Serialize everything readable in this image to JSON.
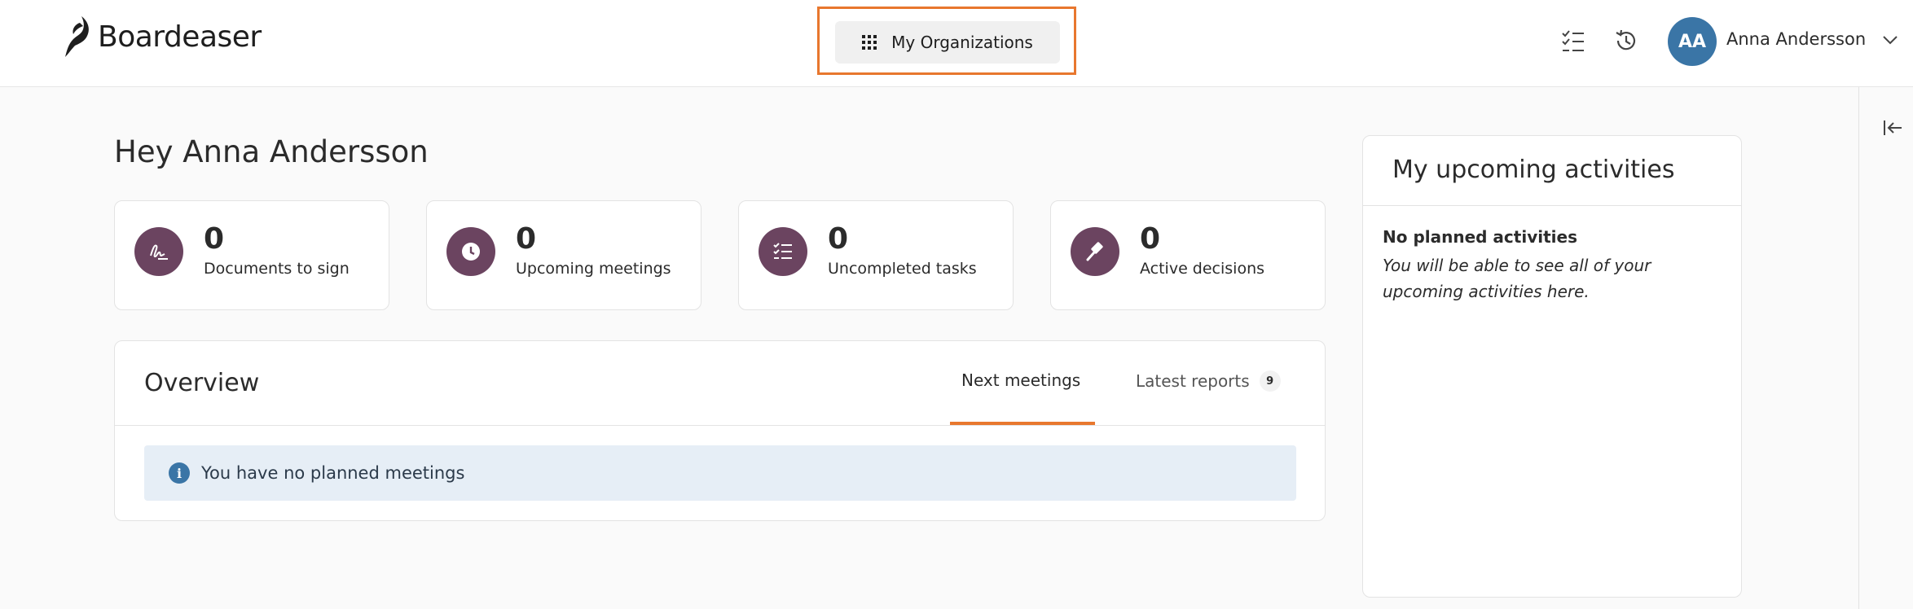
{
  "header": {
    "brand": "Boardeaser",
    "org_button_label": "My Organizations",
    "user": {
      "initials": "AA",
      "name": "Anna Andersson"
    }
  },
  "greeting": "Hey Anna Andersson",
  "stats": [
    {
      "value": "0",
      "label": "Documents to sign",
      "icon": "signature-icon"
    },
    {
      "value": "0",
      "label": "Upcoming meetings",
      "icon": "clock-icon"
    },
    {
      "value": "0",
      "label": "Uncompleted tasks",
      "icon": "checklist-icon"
    },
    {
      "value": "0",
      "label": "Active decisions",
      "icon": "gavel-icon"
    }
  ],
  "overview": {
    "title": "Overview",
    "tabs": [
      {
        "label": "Next meetings",
        "active": true
      },
      {
        "label": "Latest reports",
        "badge": "9",
        "active": false
      }
    ],
    "info_message": "You have no planned meetings"
  },
  "activities": {
    "title": "My upcoming activities",
    "empty_title": "No planned activities",
    "empty_text": "You will be able to see all of your upcoming activities here."
  },
  "colors": {
    "accent": "#e8772e",
    "stat_icon_bg": "#6b4460",
    "avatar_bg": "#3a75a6",
    "info_bg": "#e6eef6"
  }
}
